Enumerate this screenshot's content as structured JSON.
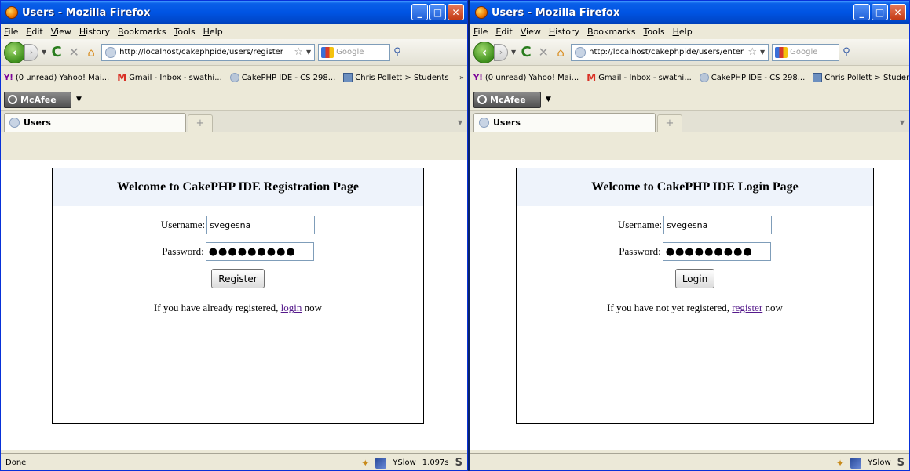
{
  "left": {
    "title": "Users - Mozilla Firefox",
    "menu": [
      "File",
      "Edit",
      "View",
      "History",
      "Bookmarks",
      "Tools",
      "Help"
    ],
    "url": "http://localhost/cakephpide/users/register",
    "search_placeholder": "Google",
    "bookmarks": [
      "(0 unread) Yahoo! Mai...",
      "Gmail - Inbox - swathi...",
      "CakePHP IDE - CS 298...",
      "Chris Pollett > Students"
    ],
    "bookmarks_more": "»",
    "mcafee_label": "McAfee",
    "tab_label": "Users",
    "heading": "Welcome to CakePHP IDE Registration Page",
    "username_label": "Username:",
    "username_value": "svegesna",
    "password_label": "Password:",
    "password_value": "●●●●●●●●●",
    "button_label": "Register",
    "footer_prefix": "If you have already registered,",
    "footer_link": "login",
    "footer_suffix": "now",
    "status_text": "Done",
    "yslow_label": "YSlow",
    "load_time": "1.097s",
    "s_label": "S"
  },
  "right": {
    "title": "Users - Mozilla Firefox",
    "menu": [
      "File",
      "Edit",
      "View",
      "History",
      "Bookmarks",
      "Tools",
      "Help"
    ],
    "url": "http://localhost/cakephpide/users/enter",
    "search_placeholder": "Google",
    "bookmarks": [
      "(0 unread) Yahoo! Mai...",
      "Gmail - Inbox - swathi...",
      "CakePHP IDE - CS 298...",
      "Chris Pollett > Students"
    ],
    "bookmarks_more": "»",
    "mcafee_label": "McAfee",
    "tab_label": "Users",
    "heading": "Welcome to CakePHP IDE Login Page",
    "username_label": "Username:",
    "username_value": "svegesna",
    "password_label": "Password:",
    "password_value": "●●●●●●●●●",
    "button_label": "Login",
    "footer_prefix": "If you have not yet registered,",
    "footer_link": "register",
    "footer_suffix": "now",
    "yslow_label": "YSlow",
    "s_label": "S"
  },
  "colors": {
    "titlebar": "#0054e3",
    "chrome": "#ece9d8",
    "visited_link": "#551a8b",
    "header_band": "#eef3fb"
  },
  "icons": [
    "firefox-logo-icon",
    "minimize-icon",
    "maximize-icon",
    "close-icon",
    "back-icon",
    "forward-icon",
    "reload-icon",
    "stop-icon",
    "home-icon",
    "bookmark-star-icon",
    "search-icon",
    "mcafee-icon",
    "puzzle-icon",
    "yslow-icon"
  ]
}
